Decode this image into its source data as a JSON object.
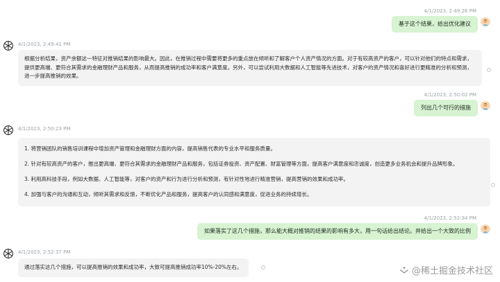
{
  "messages": [
    {
      "role": "user",
      "timestamp": "4/1/2023, 2:49:26 PM",
      "text": "基于这个结果，给出优化建议"
    },
    {
      "role": "assistant",
      "timestamp": "4/1/2023, 2:49:41 PM",
      "text": "根据分析结果，资产余额这一特征对推销结果的影响最大。因此，在推销过程中需要将更多的重点放在倾听和了解客户个人资产情况的方面。对于有较高资产的客户，可以针对他们的特点和需求，提供更高端、更符合其需求的金融理财产品和服务，从而提高推销的成功率和客户满意度。另外，可以尝试利用大数据和人工智能等先进技术，对客户的资产情况和喜好进行更精准的分析和预测，进一步提高推销的效果。"
    },
    {
      "role": "user",
      "timestamp": "4/1/2023, 2:50:02 PM",
      "text": "列出几个可行的措施"
    },
    {
      "role": "assistant",
      "timestamp": "4/1/2023, 2:50:23 PM",
      "items": [
        "1. 将营销团队的销售培训课程中增加资产管理和金融理财方面的内容，提高销售代表的专业水平和服务质量。",
        "2. 针对有较高资产的客户，推出更高端、更符合其需求的金融理财产品和服务，包括证券投资、资产配置、财富管理等方面，提高客户满意度和忠诚度，创造更多业务机会和提升品牌形象。",
        "3. 利用高科技手段，例如大数据、人工智能等，对客户的资产和行为进行分析和预测，有针对性地进行精准营销，提高营销的效果和成功率。",
        "4. 加强与客户的沟通和互动，倾听其需求和反馈，不断优化产品和服务，提高客户的认同感和满意度，促进业务的持续增长。"
      ]
    },
    {
      "role": "user",
      "timestamp": "4/1/2023, 2:52:34 PM",
      "text": "如果落实了这几个措施，那么能大概对推销的结果的影响有多大，用一句话给出结论。并给出一个大致的比例"
    },
    {
      "role": "assistant",
      "timestamp": "4/1/2023, 2:52:37 PM",
      "text": "通过落实这几个措施，可以提高推销的效果和成功率，大致可提高推销成功率10%-20%左右。"
    }
  ],
  "watermark": "@稀土掘金技术社区",
  "icons": {
    "user_avatar": "user-avatar-icon",
    "assistant_avatar": "openai-logo-icon",
    "watermark": "juejin-logo-icon"
  },
  "colors": {
    "user_bubble": "#d7f3d2",
    "assistant_bubble": "#f3f3f4",
    "timestamp": "#9aa0a6"
  }
}
